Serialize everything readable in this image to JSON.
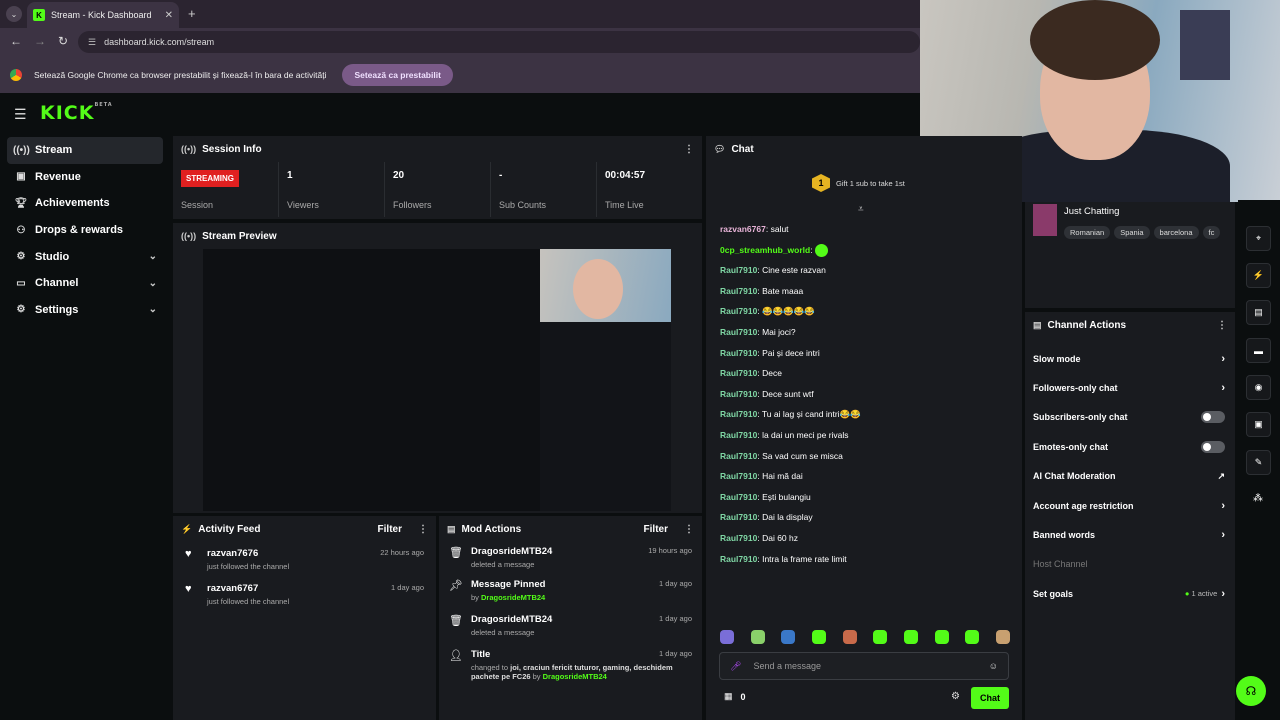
{
  "browser": {
    "tab_title": "Stream - Kick Dashboard",
    "tab_close": "✕",
    "new_tab": "+",
    "url": "dashboard.kick.com/stream",
    "infobar_text": "Setează Google Chrome ca browser prestabilit și fixează-l în bara de activități",
    "infobar_button": "Setează ca prestabilit"
  },
  "brand": {
    "logo": "KICK",
    "beta": "BETA",
    "accent": "#53fc18"
  },
  "sidebar": {
    "items": [
      {
        "label": "Stream",
        "icon": "broadcast-icon"
      },
      {
        "label": "Revenue",
        "icon": "wallet-icon"
      },
      {
        "label": "Achievements",
        "icon": "trophy-icon"
      },
      {
        "label": "Drops & rewards",
        "icon": "gift-icon"
      },
      {
        "label": "Studio",
        "icon": "gear-icon"
      },
      {
        "label": "Channel",
        "icon": "monitor-icon"
      },
      {
        "label": "Settings",
        "icon": "settings-icon"
      }
    ]
  },
  "session": {
    "title": "Session Info",
    "status": "STREAMING",
    "status_label": "Session",
    "viewers": "1",
    "viewers_label": "Viewers",
    "followers": "20",
    "followers_label": "Followers",
    "subs": "-",
    "subs_label": "Sub Counts",
    "time": "00:04:57",
    "time_label": "Time Live"
  },
  "preview": {
    "title": "Stream Preview"
  },
  "activity": {
    "title": "Activity Feed",
    "filter": "Filter",
    "items": [
      {
        "name": "razvan7676",
        "sub": "just followed the channel",
        "time": "22 hours ago"
      },
      {
        "name": "razvan6767",
        "sub": "just followed the channel",
        "time": "1 day ago"
      }
    ]
  },
  "mod": {
    "title": "Mod Actions",
    "filter": "Filter",
    "items": [
      {
        "name": "DragosrideMTB24",
        "sub": "deleted a message",
        "time": "19 hours ago"
      },
      {
        "name": "Message Pinned",
        "sub_pre": "by ",
        "sub_user": "DragosrideMTB24",
        "time": "1 day ago"
      },
      {
        "name": "DragosrideMTB24",
        "sub": "deleted a message",
        "time": "1 day ago"
      },
      {
        "name": "Title",
        "sub_pre": "changed to ",
        "sub_bold": "joi, craciun fericit tuturor, gaming, deschidem pachete pe FC26",
        "sub_mid": " by ",
        "sub_user": "DragosrideMTB24",
        "time": "1 day ago"
      }
    ]
  },
  "chat": {
    "title": "Chat",
    "gift_count": "1",
    "gift_text": "Gift 1 sub to take 1st",
    "messages": [
      {
        "user": "razvan6767",
        "text": "salut",
        "color": "#e8b4d8"
      },
      {
        "user": "0cp_streamhub_world",
        "text": "",
        "color": "#53fc18",
        "emote": true
      },
      {
        "user": "Raul7910",
        "text": "Cine este razvan",
        "color": "#7fd6a4"
      },
      {
        "user": "Raul7910",
        "text": "Bate maaa",
        "color": "#7fd6a4"
      },
      {
        "user": "Raul7910",
        "text": "😂😂😂😂😂",
        "color": "#7fd6a4"
      },
      {
        "user": "Raul7910",
        "text": "Mai joci?",
        "color": "#7fd6a4"
      },
      {
        "user": "Raul7910",
        "text": "Pai și dece intri",
        "color": "#7fd6a4"
      },
      {
        "user": "Raul7910",
        "text": "Dece",
        "color": "#7fd6a4"
      },
      {
        "user": "Raul7910",
        "text": "Dece sunt wtf",
        "color": "#7fd6a4"
      },
      {
        "user": "Raul7910",
        "text": "Tu ai lag și cand intri😂😂",
        "color": "#7fd6a4"
      },
      {
        "user": "Raul7910",
        "text": "la dai un meci pe rivals",
        "color": "#7fd6a4"
      },
      {
        "user": "Raul7910",
        "text": "Sa vad cum se misca",
        "color": "#7fd6a4"
      },
      {
        "user": "Raul7910",
        "text": "Hai mă dai",
        "color": "#7fd6a4"
      },
      {
        "user": "Raul7910",
        "text": "Ești bulangiu",
        "color": "#7fd6a4"
      },
      {
        "user": "Raul7910",
        "text": "Dai la display",
        "color": "#7fd6a4"
      },
      {
        "user": "Raul7910",
        "text": "Dai 60 hz",
        "color": "#7fd6a4"
      },
      {
        "user": "Raul7910",
        "text": "Intra la frame rate limit",
        "color": "#7fd6a4"
      }
    ],
    "placeholder": "Send a message",
    "points": "0",
    "send_label": "Chat"
  },
  "category": {
    "name": "Just Chatting",
    "tags": [
      "Romanian",
      "Spania",
      "barcelona",
      "fc"
    ]
  },
  "channel_actions": {
    "title": "Channel Actions",
    "rows": [
      {
        "label": "Slow mode",
        "kind": "chevron"
      },
      {
        "label": "Followers-only chat",
        "kind": "chevron"
      },
      {
        "label": "Subscribers-only chat",
        "kind": "toggle"
      },
      {
        "label": "Emotes-only chat",
        "kind": "toggle"
      },
      {
        "label": "AI Chat Moderation",
        "kind": "external"
      },
      {
        "label": "Account age restriction",
        "kind": "chevron"
      },
      {
        "label": "Banned words",
        "kind": "chevron"
      },
      {
        "label": "Host Channel",
        "kind": "disabled"
      },
      {
        "label": "Set goals",
        "kind": "goal",
        "badge": "1 active"
      }
    ]
  }
}
